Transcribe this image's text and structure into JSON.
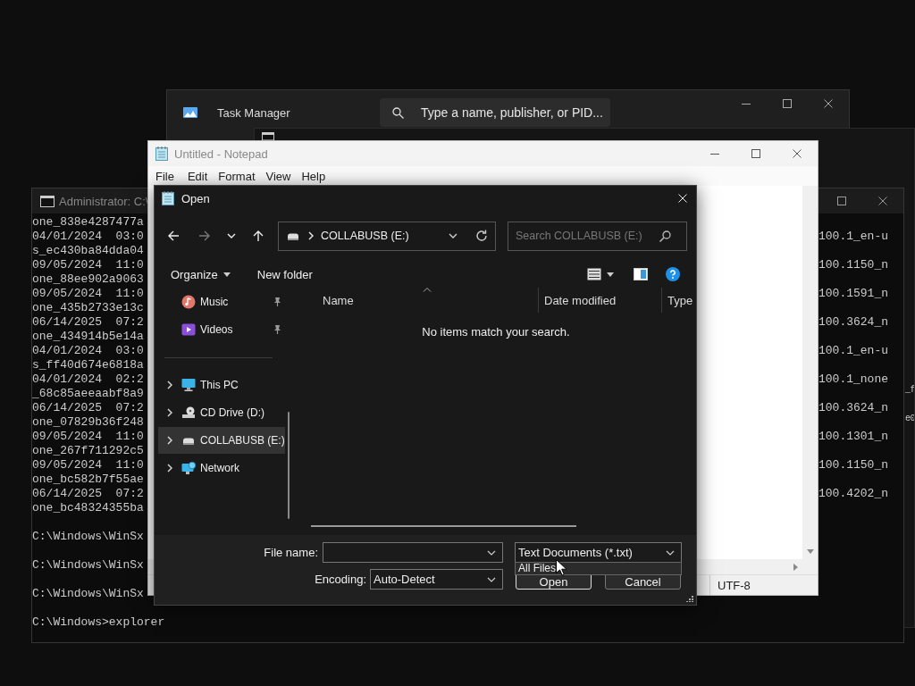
{
  "task_manager": {
    "title": "Task Manager",
    "search": {
      "placeholder": "Type a name, publisher, or PID..."
    }
  },
  "background_console": {
    "fragments": [
      "_f",
      "e0"
    ]
  },
  "console": {
    "title": "Administrator: C:\\",
    "lines": [
      {
        "left": "one_838e4287477a"
      },
      {
        "left": "04/01/2024  03:0",
        "right": "100.1_en-u"
      },
      {
        "left": "s_ec430ba84dda04"
      },
      {
        "left": "09/05/2024  11:0",
        "right": "100.1150_n"
      },
      {
        "left": "one_88ee902a9063"
      },
      {
        "left": "09/05/2024  11:0",
        "right": "100.1591_n"
      },
      {
        "left": "one_435b2733e13c"
      },
      {
        "left": "06/14/2025  07:2",
        "right": "100.3624_n"
      },
      {
        "left": "one_434914b5e14a"
      },
      {
        "left": "04/01/2024  03:0",
        "right": "100.1_en-u"
      },
      {
        "left": "s_ff40d674e6818a"
      },
      {
        "left": "04/01/2024  02:2",
        "right": "100.1_none"
      },
      {
        "left": "_68c85aeeaabf8a9"
      },
      {
        "left": "06/14/2025  07:2",
        "right": "100.3624_n"
      },
      {
        "left": "one_07829b36f248"
      },
      {
        "left": "09/05/2024  11:0",
        "right": "100.1301_n"
      },
      {
        "left": "one_267f711292c5"
      },
      {
        "left": "09/05/2024  11:0",
        "right": "100.1150_n"
      },
      {
        "left": "one_bc582b7f55ae"
      },
      {
        "left": "06/14/2025  07:2",
        "right": "100.4202_n"
      },
      {
        "left": "one_bc48324355ba"
      }
    ],
    "prompts": [
      "C:\\Windows\\WinSx",
      "C:\\Windows\\WinSx",
      "C:\\Windows\\WinSx",
      "C:\\Windows>explorer"
    ]
  },
  "notepad": {
    "title": "Untitled - Notepad",
    "menu": [
      "File",
      "Edit",
      "Format",
      "View",
      "Help"
    ],
    "status": {
      "encoding": "UTF-8"
    }
  },
  "open_dialog": {
    "title": "Open",
    "nav_buttons": [
      {
        "kind": "back",
        "disabled": false
      },
      {
        "kind": "forward",
        "disabled": true
      },
      {
        "kind": "recent",
        "disabled": false
      },
      {
        "kind": "up",
        "disabled": false
      }
    ],
    "address": {
      "location": "COLLABUSB (E:)"
    },
    "search": {
      "placeholder": "Search COLLABUSB (E:)"
    },
    "toolbar": {
      "organize": "Organize",
      "new_folder": "New folder"
    },
    "quick_access": [
      {
        "label": "Music",
        "kind": "music",
        "pinned": true,
        "selected": false
      },
      {
        "label": "Videos",
        "kind": "videos",
        "pinned": true,
        "selected": false
      }
    ],
    "locations": [
      {
        "label": "This PC",
        "kind": "pc",
        "expanded": false,
        "selected": false
      },
      {
        "label": "CD Drive (D:)",
        "kind": "cd",
        "expanded": false,
        "selected": false
      },
      {
        "label": "COLLABUSB (E:)",
        "kind": "usb",
        "expanded": false,
        "selected": true
      },
      {
        "label": "Network",
        "kind": "network",
        "expanded": false,
        "selected": false
      }
    ],
    "columns": [
      {
        "label": "Name",
        "sorted": true
      },
      {
        "label": "Date modified",
        "sorted": false
      },
      {
        "label": "Type",
        "sorted": false
      }
    ],
    "empty_message": "No items match your search.",
    "file_name": {
      "label": "File name:"
    },
    "file_type": {
      "value": "Text Documents (*.txt)",
      "expanded": true,
      "options": [
        "All Files"
      ]
    },
    "encoding": {
      "label": "Encoding:",
      "value": "Auto-Detect"
    },
    "buttons": [
      {
        "label": "Open",
        "kind": "primary"
      },
      {
        "label": "Cancel",
        "kind": "secondary"
      }
    ]
  }
}
